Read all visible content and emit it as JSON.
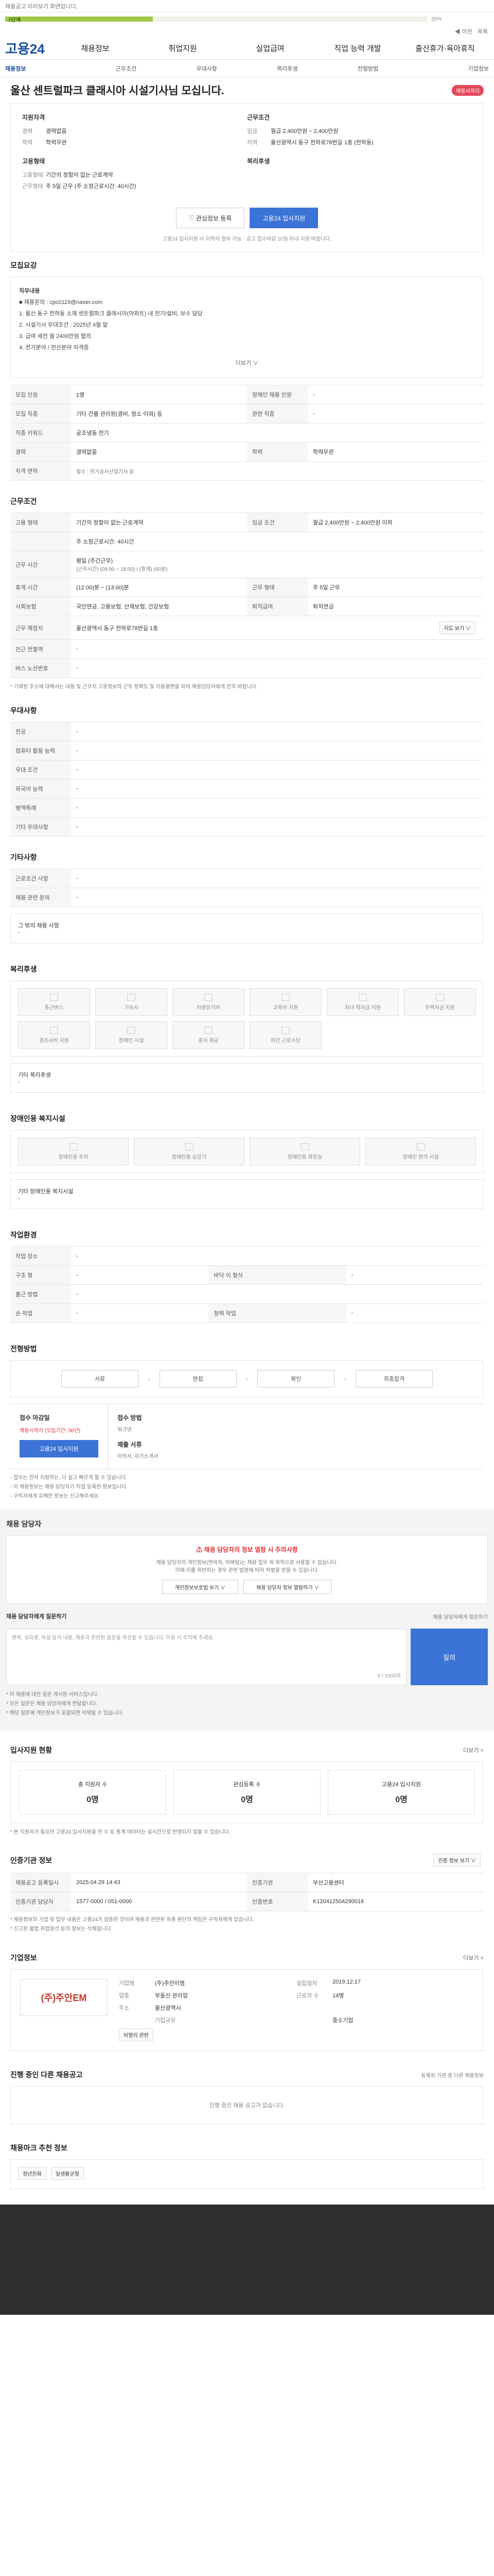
{
  "topbar": {
    "notice": "채용공고 미리보기 화면입니다."
  },
  "progress": {
    "value": 35,
    "step": "1단계",
    "label": "35%"
  },
  "backbar": {
    "items": [
      "◀ 이전",
      "목록"
    ]
  },
  "gnb": {
    "logo": "고용24",
    "items": [
      "채용정보",
      "취업지원",
      "실업급여",
      "직업 능력 개발",
      "출산휴가·육아휴직"
    ]
  },
  "snb": {
    "items": [
      "채용정보",
      "근무조건",
      "우대사항",
      "복리후생",
      "전형방법",
      "기업정보"
    ]
  },
  "headline": {
    "title": "울산 센트럴파크 클래시아 시설기사님 모십니다.",
    "badge": "채용시까지"
  },
  "summary": {
    "left_title": "지원자격",
    "left": [
      {
        "k": "경력",
        "v": "경력없음"
      },
      {
        "k": "학력",
        "v": "학력무관"
      }
    ],
    "right_title": "근무조건",
    "right": [
      {
        "k": "임금",
        "v": "월급 2,400만원 ~ 2,400만원"
      },
      {
        "k": "지역",
        "v": "울산광역시 동구 전하로78번길 1층 (전하동)"
      }
    ],
    "left2_title": "고용형태",
    "left2": [
      {
        "k": "고용형태",
        "v": "기간의 정함이 없는 근로계약"
      },
      {
        "k": "근무형태",
        "v": "주 5일 근무 (주 소정근로시간: 40시간)"
      }
    ],
    "right2_title": "복리후생"
  },
  "actions": {
    "scrap": "관심정보 등록",
    "apply": "고용24 입사지원",
    "note": "고용24 입사지원 시 이력서 첨부 가능 · 공고 접수마감 10일 이내 지원 바랍니다."
  },
  "job": {
    "title": "모집요강",
    "desc_title": "직무내용",
    "lines": [
      "■ 채용문의 : cpc0119@naver.com",
      "1. 울산 동구 전하동 소재 센트럴파크 클래시아(아파트) 내 전기/설비, 보수 담당",
      "2. 시설기사 우대조건 : 2025년 4월 말",
      "3. 급여 세전 월 2400만원 협의",
      "4. 전기분야 / 전산분야 자격증"
    ],
    "more": "더보기 ∨"
  },
  "job_table": [
    [
      {
        "k": "모집 인원",
        "v": "1명"
      },
      {
        "k": "장애인 채용 인원",
        "v": "-"
      }
    ],
    [
      {
        "k": "모집 직종",
        "v": "기타 건물 관리원(경비, 청소 이외) 등"
      },
      {
        "k": "관련 직종",
        "v": "-"
      }
    ],
    [
      {
        "k": "직종 키워드",
        "v": "공조냉동 전기"
      },
      {
        "k": "",
        "v": ""
      }
    ],
    [
      {
        "k": "경력",
        "v": "경력없음"
      },
      {
        "k": "학력",
        "v": "학력무관"
      }
    ],
    [
      {
        "k": "자격 면허",
        "v": "필수"
      },
      {
        "k": "",
        "v": ""
      }
    ]
  ],
  "license_note": "필수 : 전기공사산업기사 등",
  "work": {
    "title": "근무조건",
    "rows": [
      {
        "k": "고용 형태",
        "v": "기간의 정함이 없는 근로계약",
        "k2": "임금 조건",
        "v2": "월급 2,400만원 ~ 2,400만원 이하"
      },
      {
        "k": "",
        "v": "주 소정근로시간: 40시간",
        "k2": "",
        "v2": ""
      },
      {
        "k": "근무 시간",
        "v": "평일 (주간근무)",
        "k2": "",
        "v2": ""
      },
      {
        "k": "",
        "v": "(근무시간) (09:00 ~ 18:00) / (휴게) (60분)",
        "k2": "",
        "v2": ""
      },
      {
        "k": "휴게 시간",
        "v": "(12:00)분 ~ (13:00)분",
        "k2": "근무 형태",
        "v2": "주 5일 근무"
      },
      {
        "k": "사회보험",
        "v": "국민연금, 고용보험, 산재보험, 건강보험",
        "k2": "퇴직급여",
        "v2": "퇴직연금"
      },
      {
        "k": "근무 예정지",
        "v": "울산광역시 동구 전하로78번길 1층",
        "k2": "",
        "v2": ""
      },
      {
        "k": "인근 전철역",
        "v": "-",
        "k2": "",
        "v2": ""
      },
      {
        "k": "버스 노선번호",
        "v": "-",
        "k2": "",
        "v2": ""
      }
    ],
    "map_btn": "지도 보기 ∨",
    "footnote": "* 기재된 주소에 대해서는 내용 및 근무지 고용정보의 근무 정확도 및 이용불편을 되어 채용담당자에게 문의 바랍니다."
  },
  "pref": {
    "title": "우대사항",
    "rows": [
      {
        "k": "전공",
        "v": "-"
      },
      {
        "k": "컴퓨터 활용 능력",
        "v": "-"
      },
      {
        "k": "우대 조건",
        "v": "-"
      },
      {
        "k": "외국어 능력",
        "v": "-"
      },
      {
        "k": "병역특례",
        "v": "-"
      },
      {
        "k": "기타 우대사항",
        "v": "-"
      }
    ]
  },
  "etc": {
    "title": "기타사항",
    "rows": [
      {
        "k": "근로조건 사항",
        "v": "-"
      },
      {
        "k": "채용 관련 문의",
        "v": "-"
      }
    ],
    "other_label": "그 밖의 채용 사항"
  },
  "welfare": {
    "title": "복리후생",
    "items": [
      "통근버스",
      "기숙사",
      "차량유지비",
      "교육비 지원",
      "자녀 학자금 지원",
      "주택자금 지원",
      "경조사비 지원",
      "장애인 시설",
      "중식 제공",
      "야간 근로수당",
      "",
      ""
    ],
    "other_label": "기타 복리후생"
  },
  "disabled": {
    "title": "장애인용 복지시설",
    "items": [
      "장애인용 주차",
      "장애인용 승강기",
      "장애인용 화장실",
      "장애인 편의 시설"
    ],
    "other_label": "기타 장애인용 복지시설"
  },
  "work_env": {
    "title": "작업환경",
    "rows": [
      {
        "k": "작업 장소",
        "v": "-",
        "k2": "",
        "v2": ""
      },
      {
        "k": "구조 형",
        "v": "-",
        "k2": "바닥 이 형식",
        "v2": "-"
      },
      {
        "k": "출근 방법",
        "v": "-",
        "k2": "",
        "v2": ""
      },
      {
        "k": "손 작업",
        "v": "-",
        "k2": "청력 작업"
      }
    ]
  },
  "process": {
    "title": "전형방법",
    "steps": [
      "서류",
      "면접",
      "확인",
      "최종합격"
    ]
  },
  "apply": {
    "label1": "접수 마감일",
    "date": "채용시까지 (모집기간: 30년)",
    "btn": "고용24 입사지원",
    "label2": "접수 방법",
    "method": "워크넷",
    "label3": "제출 서류",
    "docs": "이력서, 자기소개서",
    "notes": [
      "- 접수는 전자 지원하는, 더 쉽고 빠르게 할 수 있습니다.",
      "- 이 채용정보는 채용 담당자가 직접 등록한 정보입니다.",
      "- 구직자에게 유해한 정보는 신고해주세요."
    ]
  },
  "manager": {
    "title": "채용 담당자",
    "alert": "채용 담당자의 정보 열람 시 주의사항",
    "msg1": "채용 담당자의 개인정보(연락처, 이메일)는 채용 업무 외 목적으로 사용할 수 없습니다.",
    "msg2": "이에 이를 위반하는 경우 관련 법령에 따라 처벌을 받을 수 있습니다.",
    "btn1": "개인정보보호법 보기 ∨",
    "btn2": "채용 담당자 정보 열람하기 ∨",
    "qa_title": "채용 담당자에게 질문하기",
    "qa_right": "채용 담당자에게 질문하기",
    "qa_placeholder": "연락, 성희롱, 욕설 등의 내용, 채용과 관련된 질문을 작성할 수 있습니다. 이용 시 주의해 주세요.",
    "qa_count": "0 / 1000자",
    "qa_btn": "질의",
    "qa_notes": [
      "* 이 채용에 대한 질문 게시판 서비스입니다.",
      "* 모든 질문은 채용 담당자에게 전달됩니다.",
      "* 해당 질문에 개인정보가 포함되면 삭제될 수 있습니다."
    ]
  },
  "status": {
    "title": "입사지원 현황",
    "more": "더보기 >",
    "items": [
      {
        "label": "총 지원자 수",
        "n": "0명"
      },
      {
        "label": "관심등록 수",
        "n": "0명"
      },
      {
        "label": "고용24 입사지원",
        "n": "0명"
      }
    ],
    "note": "* 본 지원자가 필요한 고용24 입사지원을 한 수 등 통계 데이터는 실시간으로 반영되지 않을 수 있습니다."
  },
  "agency": {
    "title": "인증기관 정보",
    "btn": "인증 정보 보기 ∨",
    "rows": [
      {
        "k": "채용공고 등록일시",
        "v": "2025.04.29 14:43",
        "k2": "인증기관",
        "v2": "부산고용센터"
      },
      {
        "k": "인증기관 담당자",
        "v": "1577-0000 / 051-0000",
        "k2": "인증번호",
        "v2": "K120412504290016"
      }
    ],
    "notes": [
      "* 채용정보의 기업 및 업무 내용은 고용24가 검증한 것이며 채용과 관련된 최종 판단의 책임은 구직자에게 있습니다.",
      "* 신고된 불법 취업알선 등의 정보는 삭제됩니다."
    ]
  },
  "company": {
    "title": "기업정보",
    "logo": "(주)주안EM",
    "more": "더보기 >",
    "cells": [
      {
        "k": "기업명",
        "v": "(주)주안이엠",
        "k2": "설립일자",
        "v2": "2019.12.17"
      },
      {
        "k": "업종",
        "v": "부동산 관리업",
        "k2": "근로자 수",
        "v2": "14명"
      },
      {
        "k": "주소",
        "v": "울산광역시",
        "k2": "",
        "v2": ""
      },
      {
        "k": "",
        "v": "기업규모",
        "k2": "",
        "v2": "중소기업"
      }
    ],
    "chips": [
      "비영리 관련"
    ]
  },
  "other_jobs": {
    "title": "진행 중인 다른 채용공고",
    "right": "등록된 기관 중 다른 채용정보",
    "empty": "진행 중인 채용 공고가 없습니다."
  },
  "certs": {
    "title": "채용마크 추천 정보",
    "tags": [
      "청년친화",
      "일생활균형"
    ]
  }
}
